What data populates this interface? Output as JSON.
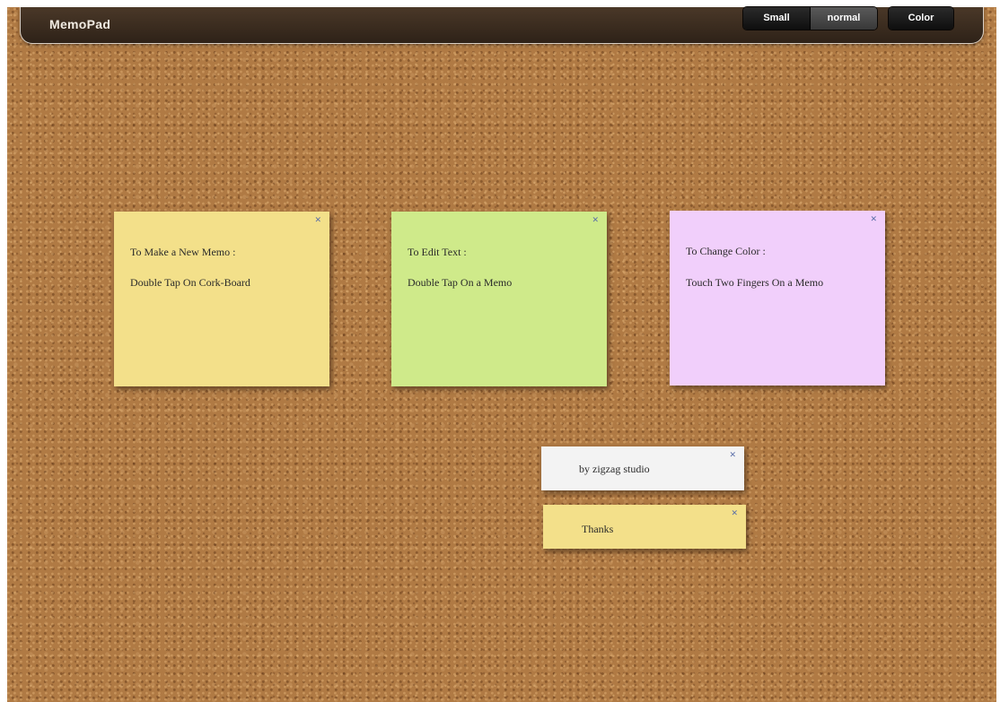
{
  "app": {
    "title": "MemoPad"
  },
  "toolbar": {
    "size_options": [
      "Small",
      "normal"
    ],
    "selected_size": "normal",
    "color_label": "Color"
  },
  "memos": [
    {
      "color": "#f3e08a",
      "line1": "To Make a New Memo :",
      "line2": "Double Tap On  Cork-Board",
      "close_icon": "close-x-icon"
    },
    {
      "color": "#cfea8a",
      "line1": "To Edit Text :",
      "line2": "Double Tap On a Memo",
      "close_icon": "close-x-icon"
    },
    {
      "color": "#f1cffb",
      "line1": "To Change Color :",
      "line2": "Touch Two Fingers On a Memo",
      "close_icon": "close-x-icon"
    },
    {
      "color": "#f3f3f3",
      "line1": "by zigzag studio",
      "close_icon": "close-x-icon"
    },
    {
      "color": "#f3e08a",
      "line1": "Thanks",
      "close_icon": "close-x-icon"
    }
  ]
}
